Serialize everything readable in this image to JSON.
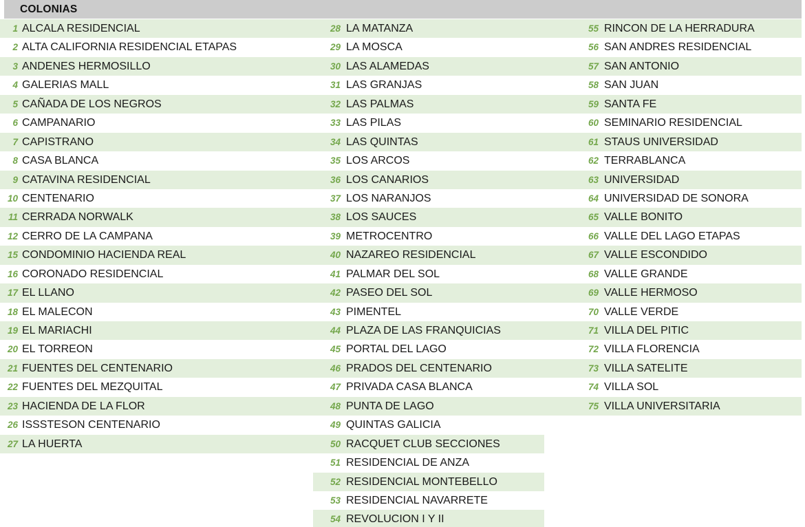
{
  "header": {
    "title": "COLONIAS"
  },
  "colors": {
    "header_band": "#cccccc",
    "row_shade": "#e3efdc",
    "number_green": "#74a74c",
    "label_text": "#1a1a1a",
    "page_background": "#ffffff"
  },
  "columns": [
    {
      "id": "column-1",
      "rows": [
        {
          "num": "1",
          "label": "ALCALA RESIDENCIAL",
          "shaded": true
        },
        {
          "num": "2",
          "label": "ALTA CALIFORNIA RESIDENCIAL ETAPAS",
          "shaded": false
        },
        {
          "num": "3",
          "label": "ANDENES HERMOSILLO",
          "shaded": true
        },
        {
          "num": "4",
          "label": "GALERIAS MALL",
          "shaded": false
        },
        {
          "num": "5",
          "label": "CAÑADA DE LOS NEGROS",
          "shaded": true
        },
        {
          "num": "6",
          "label": "CAMPANARIO",
          "shaded": false
        },
        {
          "num": "7",
          "label": "CAPISTRANO",
          "shaded": true
        },
        {
          "num": "8",
          "label": "CASA BLANCA",
          "shaded": false
        },
        {
          "num": "9",
          "label": "CATAVINA RESIDENCIAL",
          "shaded": true
        },
        {
          "num": "10",
          "label": "CENTENARIO",
          "shaded": false
        },
        {
          "num": "11",
          "label": "CERRADA NORWALK",
          "shaded": true
        },
        {
          "num": "12",
          "label": "CERRO DE LA CAMPANA",
          "shaded": false
        },
        {
          "num": "15",
          "label": "CONDOMINIO HACIENDA REAL",
          "shaded": true
        },
        {
          "num": "16",
          "label": "CORONADO RESIDENCIAL",
          "shaded": false
        },
        {
          "num": "17",
          "label": "EL LLANO",
          "shaded": true
        },
        {
          "num": "18",
          "label": "EL MALECON",
          "shaded": false
        },
        {
          "num": "19",
          "label": "EL MARIACHI",
          "shaded": true
        },
        {
          "num": "20",
          "label": "EL TORREON",
          "shaded": false
        },
        {
          "num": "21",
          "label": "FUENTES DEL CENTENARIO",
          "shaded": true
        },
        {
          "num": "22",
          "label": "FUENTES DEL MEZQUITAL",
          "shaded": false
        },
        {
          "num": "23",
          "label": "HACIENDA DE LA FLOR",
          "shaded": true
        },
        {
          "num": "26",
          "label": "ISSSTESON CENTENARIO",
          "shaded": false
        },
        {
          "num": "27",
          "label": "LA HUERTA",
          "shaded": true
        }
      ]
    },
    {
      "id": "column-2",
      "rows": [
        {
          "num": "28",
          "label": "LA MATANZA",
          "shaded": true,
          "narrow": false
        },
        {
          "num": "29",
          "label": "LA MOSCA",
          "shaded": false,
          "narrow": false
        },
        {
          "num": "30",
          "label": "LAS ALAMEDAS",
          "shaded": true,
          "narrow": false
        },
        {
          "num": "31",
          "label": "LAS GRANJAS",
          "shaded": false,
          "narrow": false
        },
        {
          "num": "32",
          "label": "LAS PALMAS",
          "shaded": true,
          "narrow": false
        },
        {
          "num": "33",
          "label": "LAS PILAS",
          "shaded": false,
          "narrow": false
        },
        {
          "num": "34",
          "label": "LAS QUINTAS",
          "shaded": true,
          "narrow": false
        },
        {
          "num": "35",
          "label": "LOS ARCOS",
          "shaded": false,
          "narrow": false
        },
        {
          "num": "36",
          "label": "LOS CANARIOS",
          "shaded": true,
          "narrow": false
        },
        {
          "num": "37",
          "label": "LOS NARANJOS",
          "shaded": false,
          "narrow": false
        },
        {
          "num": "38",
          "label": "LOS SAUCES",
          "shaded": true,
          "narrow": false
        },
        {
          "num": "39",
          "label": "METROCENTRO",
          "shaded": false,
          "narrow": false
        },
        {
          "num": "40",
          "label": "NAZAREO RESIDENCIAL",
          "shaded": true,
          "narrow": false
        },
        {
          "num": "41",
          "label": "PALMAR DEL SOL",
          "shaded": false,
          "narrow": false
        },
        {
          "num": "42",
          "label": "PASEO DEL SOL",
          "shaded": true,
          "narrow": false
        },
        {
          "num": "43",
          "label": "PIMENTEL",
          "shaded": false,
          "narrow": false
        },
        {
          "num": "44",
          "label": "PLAZA DE LAS FRANQUICIAS",
          "shaded": true,
          "narrow": false
        },
        {
          "num": "45",
          "label": "PORTAL DEL LAGO",
          "shaded": false,
          "narrow": false
        },
        {
          "num": "46",
          "label": "PRADOS DEL CENTENARIO",
          "shaded": true,
          "narrow": false
        },
        {
          "num": "47",
          "label": "PRIVADA CASA BLANCA",
          "shaded": false,
          "narrow": false
        },
        {
          "num": "48",
          "label": "PUNTA DE LAGO",
          "shaded": true,
          "narrow": false
        },
        {
          "num": "49",
          "label": "QUINTAS GALICIA",
          "shaded": false,
          "narrow": true
        },
        {
          "num": "50",
          "label": "RACQUET CLUB SECCIONES",
          "shaded": true,
          "narrow": true
        },
        {
          "num": "51",
          "label": "RESIDENCIAL DE ANZA",
          "shaded": false,
          "narrow": true
        },
        {
          "num": "52",
          "label": "RESIDENCIAL MONTEBELLO",
          "shaded": true,
          "narrow": true
        },
        {
          "num": "53",
          "label": "RESIDENCIAL NAVARRETE",
          "shaded": false,
          "narrow": true
        },
        {
          "num": "54",
          "label": "REVOLUCION I Y II",
          "shaded": true,
          "narrow": true
        }
      ]
    },
    {
      "id": "column-3",
      "rows": [
        {
          "num": "55",
          "label": "RINCON DE LA HERRADURA",
          "shaded": true
        },
        {
          "num": "56",
          "label": "SAN ANDRES RESIDENCIAL",
          "shaded": false
        },
        {
          "num": "57",
          "label": "SAN ANTONIO",
          "shaded": true
        },
        {
          "num": "58",
          "label": "SAN JUAN",
          "shaded": false
        },
        {
          "num": "59",
          "label": "SANTA FE",
          "shaded": true
        },
        {
          "num": "60",
          "label": "SEMINARIO RESIDENCIAL",
          "shaded": false
        },
        {
          "num": "61",
          "label": "STAUS UNIVERSIDAD",
          "shaded": true
        },
        {
          "num": "62",
          "label": "TERRABLANCA",
          "shaded": false
        },
        {
          "num": "63",
          "label": "UNIVERSIDAD",
          "shaded": true
        },
        {
          "num": "64",
          "label": "UNIVERSIDAD DE SONORA",
          "shaded": false
        },
        {
          "num": "65",
          "label": "VALLE BONITO",
          "shaded": true
        },
        {
          "num": "66",
          "label": "VALLE DEL LAGO ETAPAS",
          "shaded": false
        },
        {
          "num": "67",
          "label": "VALLE ESCONDIDO",
          "shaded": true
        },
        {
          "num": "68",
          "label": "VALLE GRANDE",
          "shaded": false
        },
        {
          "num": "69",
          "label": "VALLE HERMOSO",
          "shaded": true
        },
        {
          "num": "70",
          "label": "VALLE VERDE",
          "shaded": false
        },
        {
          "num": "71",
          "label": "VILLA DEL PITIC",
          "shaded": true
        },
        {
          "num": "72",
          "label": "VILLA FLORENCIA",
          "shaded": false
        },
        {
          "num": "73",
          "label": "VILLA SATELITE",
          "shaded": true
        },
        {
          "num": "74",
          "label": "VILLA SOL",
          "shaded": false
        },
        {
          "num": "75",
          "label": "VILLA UNIVERSITARIA",
          "shaded": true
        }
      ]
    }
  ]
}
